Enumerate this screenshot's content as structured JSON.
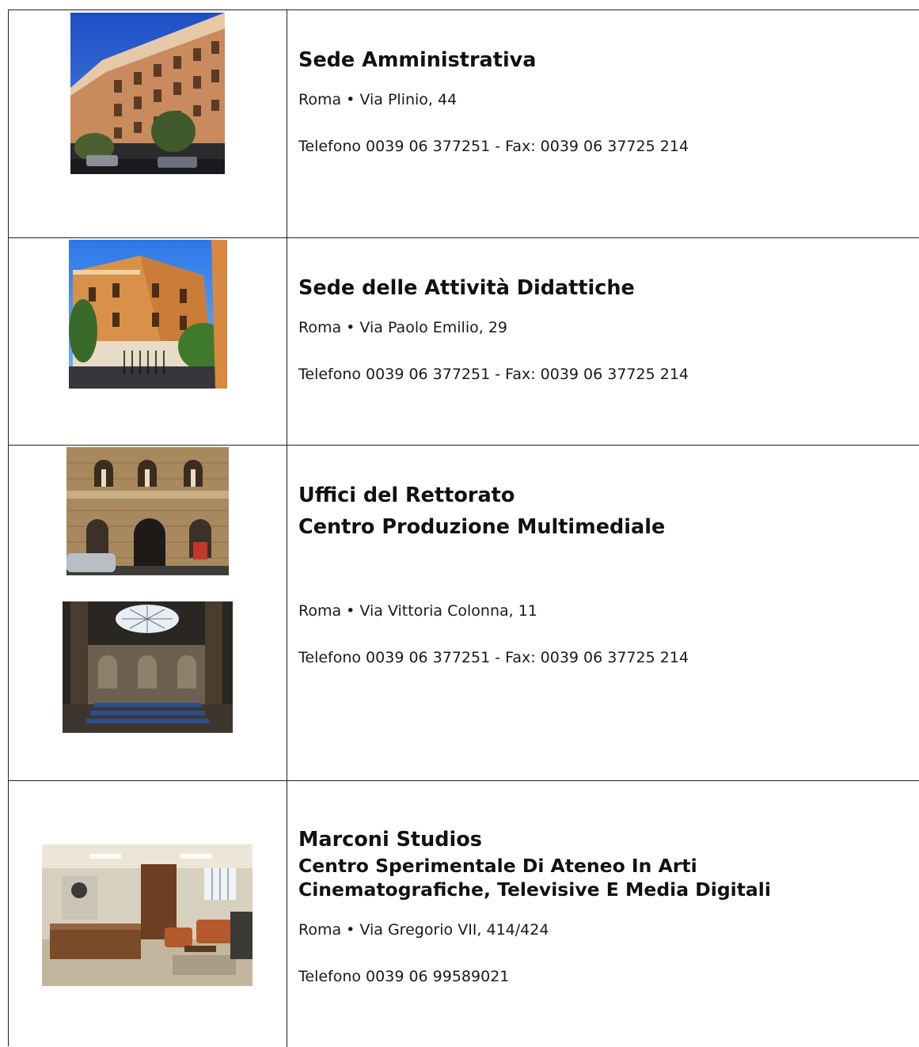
{
  "offices": [
    {
      "title_lines": [
        "Sede Amministrativa"
      ],
      "address": "Roma • Via Plinio, 44",
      "phone": "Telefono 0039 06 377251 - Fax: 0039 06 37725 214"
    },
    {
      "title_lines": [
        "Sede delle Attività Didattiche"
      ],
      "address": "Roma • Via Paolo Emilio, 29",
      "phone": "Telefono 0039 06 377251 - Fax: 0039 06 37725 214"
    },
    {
      "title_lines": [
        "Uffici del Rettorato",
        "Centro Produzione Multimediale"
      ],
      "address": "Roma • Via Vittoria Colonna, 11",
      "phone": "Telefono 0039 06 377251 - Fax: 0039 06 37725 214"
    },
    {
      "title_lines": [
        "Marconi Studios"
      ],
      "subtitle_lines": [
        "Centro Sperimentale Di Ateneo In Arti",
        "Cinematografiche, Televisive E Media Digitali"
      ],
      "address": "Roma • Via Gregorio VII, 414/424",
      "phone": "Telefono 0039 06 99589021"
    }
  ]
}
